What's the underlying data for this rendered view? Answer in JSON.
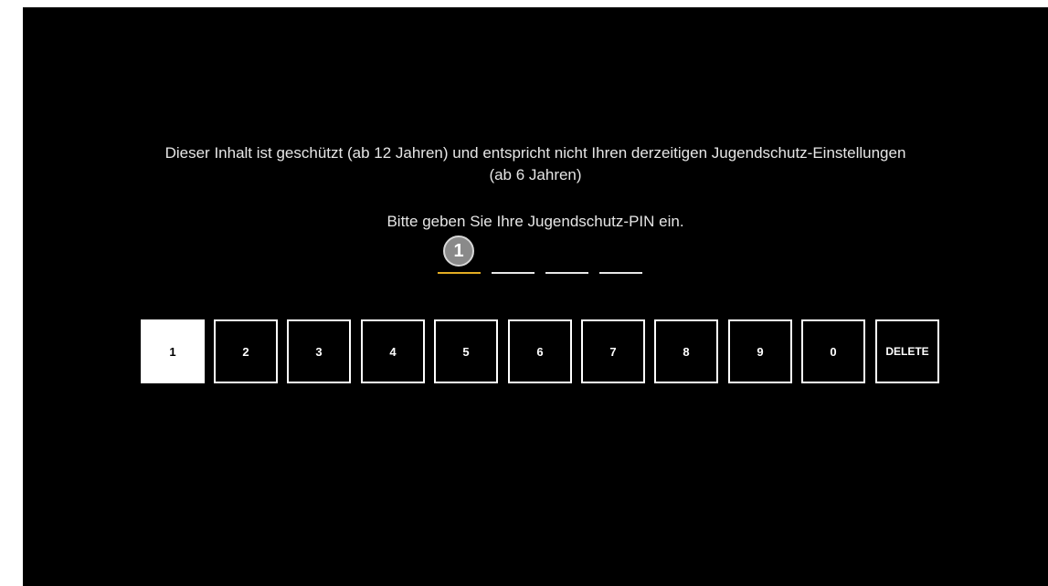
{
  "message": {
    "line1": "Dieser Inhalt ist geschützt (ab 12 Jahren) und entspricht nicht Ihren derzeitigen Jugendschutz-Einstellungen",
    "line2": "(ab 6 Jahren)",
    "prompt": "Bitte geben Sie Ihre Jugendschutz-PIN ein."
  },
  "step_marker": "1",
  "pin": {
    "length": 4,
    "active_index": 0
  },
  "keypad": {
    "keys": [
      "1",
      "2",
      "3",
      "4",
      "5",
      "6",
      "7",
      "8",
      "9",
      "0",
      "DELETE"
    ],
    "focused_index": 0
  },
  "colors": {
    "background": "#000000",
    "text": "#e6e6e6",
    "active_slot": "#e3ad23",
    "key_border": "#ffffff"
  }
}
